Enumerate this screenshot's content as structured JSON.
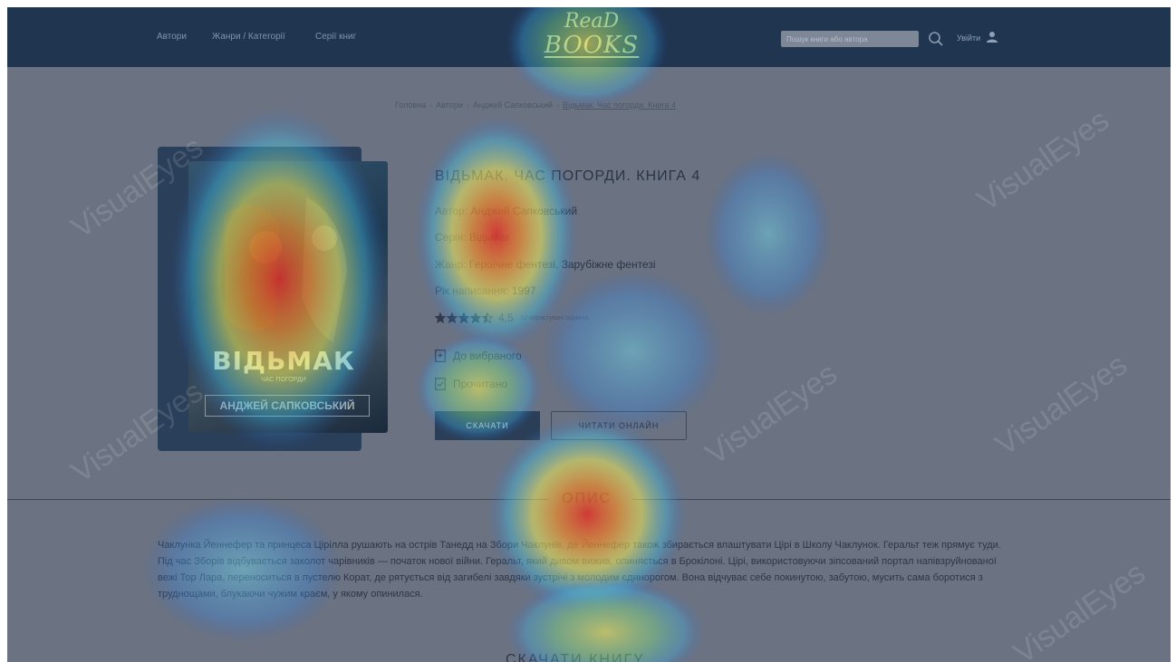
{
  "header": {
    "nav": [
      "Автори",
      "Жанри / Категорії",
      "Серії книг"
    ],
    "logo_line1": "ReaD",
    "logo_line2": "BOOKS",
    "search_placeholder": "Пошук книги або автора",
    "login_label": "Увійти"
  },
  "breadcrumb": [
    "Головна",
    "Автори",
    "Анджей Сапковський",
    "Відьмак. Час погорди. Книга 4"
  ],
  "book": {
    "cover_title": "ВІДЬМАК",
    "cover_subtitle": "ЧАС ПОГОРДИ",
    "cover_author": "АНДЖЕЙ САПКОВСЬКИЙ",
    "title": "ВІДЬМАК. ЧАС ПОГОРДИ. КНИГА 4",
    "author_label": "Автор:",
    "author": "Анджей Сапковський",
    "series_label": "Серія:",
    "series": "Відьмак",
    "genre_label": "Жанр:",
    "genre": "Героїчне фентезі, Зарубіжне фентезі",
    "year_label": "Рік написання:",
    "year": "1997",
    "rating": "4,5",
    "rating_stars": 4.5,
    "votes": "32 користувачі оцінили",
    "favorite": "До вибраного",
    "read_mark": "Прочитано",
    "download": "СКАЧАТИ",
    "read_online": "ЧИТАТИ ОНЛАЙН"
  },
  "description": {
    "heading": "ОПИС",
    "text": "Чаклунка Йеннефер та принцеса Цірілла рушають на острів Танедд на Збори Чаклунів, де Йеннефер також збирається влаштувати Цірі в Школу Чаклунок. Геральт теж прямує туди. Під час Зборів відбувається заколот чарівників — початок нової війни. Геральт, який дивом вижив, опиняється в Брокілоні. Цірі, використовуючи зіпсований портал напівзруйнованої вежі Тор Лара, переноситься в пустелю Корат, де рятується від загибелі завдяки зустрічі з молодим єдинорогом. Вона відчуває себе покинутою, забутою, мусить сама боротися з труднощами, блукаючи чужим краєм, у якому опинилася."
  },
  "download_heading": "СКАЧАТИ КНИГУ",
  "watermark": "VisualEyes",
  "colors": {
    "header_bg": "#1f3550",
    "page_overlay": "#6b7382",
    "button_bg": "#2a3f57"
  }
}
